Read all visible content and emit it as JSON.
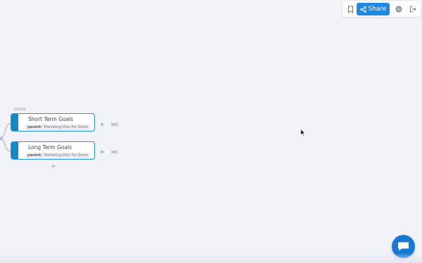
{
  "toolbar": {
    "bookmark_icon": "bookmark-icon",
    "share_icon": "share-icon",
    "share_label": "Share",
    "globe_icon": "globe-icon",
    "logout_icon": "logout-icon",
    "accent_color": "#1e88e5"
  },
  "mindmap": {
    "section_label": "IDEAS",
    "nodes": [
      {
        "title": "Short Term Goals",
        "parent_key": "parent:",
        "parent_value": "Marketing Plan For Zoom"
      },
      {
        "title": "Long Term Goals",
        "parent_key": "parent:",
        "parent_value": "Marketing Plan For Zoom"
      }
    ],
    "add_symbol": "+",
    "node_color": "#1589c6"
  },
  "chat": {
    "icon": "chat-bubble-icon",
    "color": "#1478d4"
  }
}
